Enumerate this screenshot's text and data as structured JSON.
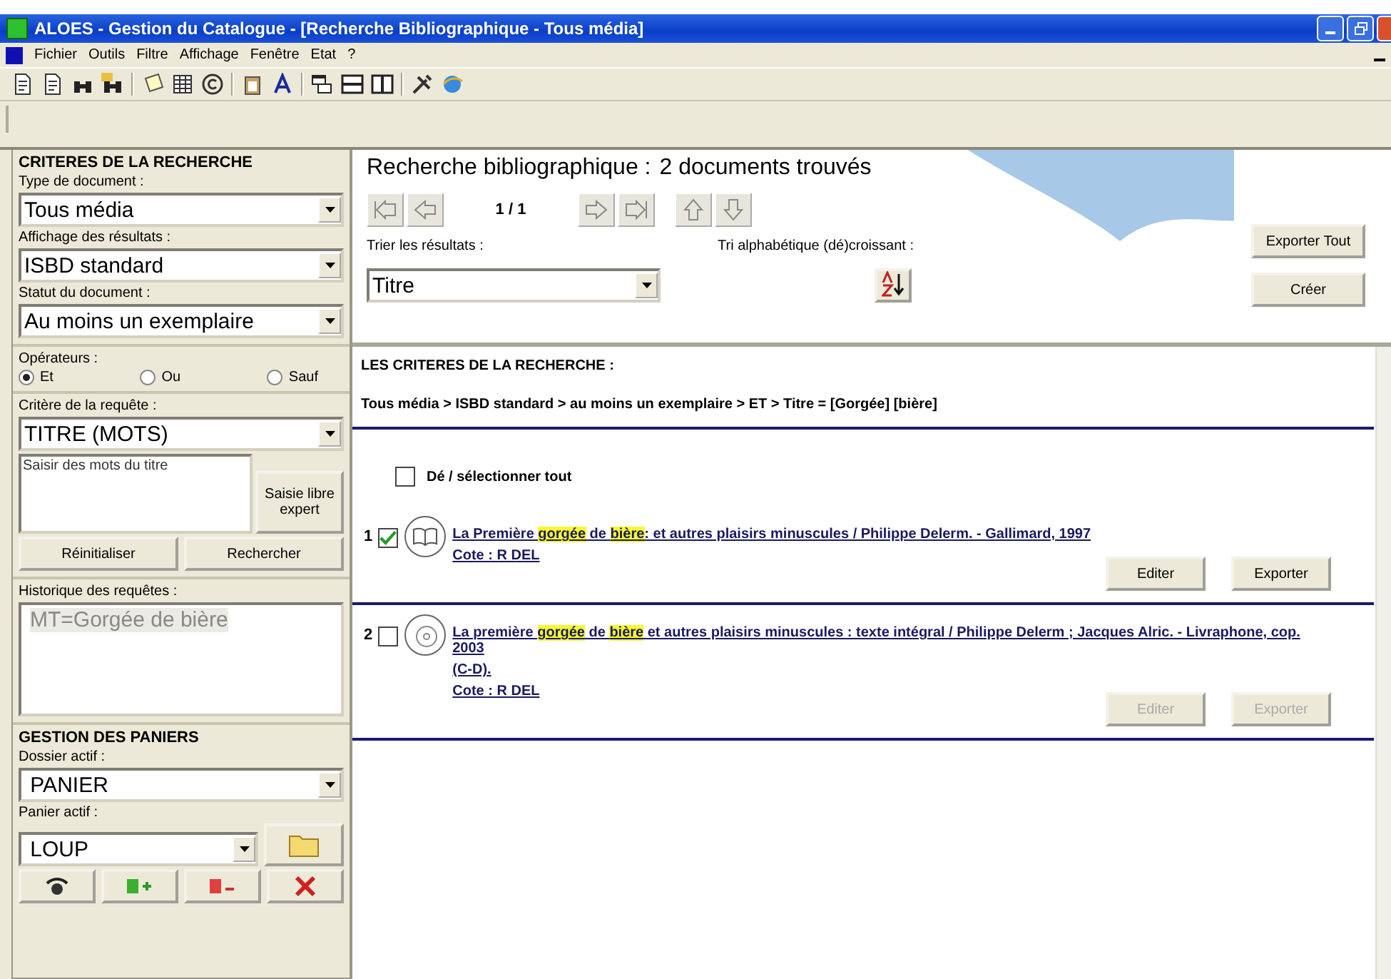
{
  "window": {
    "title": "ALOES - Gestion du Catalogue - [Recherche Bibliographique - Tous média]"
  },
  "menu": [
    "Fichier",
    "Outils",
    "Filtre",
    "Affichage",
    "Fenêtre",
    "Etat",
    "?"
  ],
  "search_panel": {
    "title": "CRITERES DE LA RECHERCHE",
    "selects": [
      {
        "label": "Type de document :",
        "value": "Tous média"
      },
      {
        "label": "Affichage des résultats :",
        "value": "ISBD standard"
      },
      {
        "label": "Statut du document :",
        "value": "Au moins un exemplaire"
      }
    ],
    "operators_label": "Opérateurs :",
    "operators": [
      {
        "label": "Et",
        "selected": true
      },
      {
        "label": "Ou",
        "selected": false
      },
      {
        "label": "Sauf",
        "selected": false
      }
    ],
    "criterion_label": "Critère de la requête :",
    "criterion_value": "TITRE (MOTS)",
    "query": {
      "placeholder": "Saisir des mots du titre"
    },
    "expert_button": "Saisie libre expert",
    "buttons": [
      "Réinitialiser",
      "Rechercher"
    ],
    "history_label": "Historique des requêtes :",
    "history": [
      "MT=Gorgée de bière"
    ]
  },
  "baskets": {
    "title": "GESTION DES PANIERS",
    "folder_label": "Dossier actif :",
    "folder_value": "PANIER",
    "basket_label": "Panier actif :",
    "basket_value": "LOUP"
  },
  "results": {
    "heading": "Recherche bibliographique :",
    "count": "2 documents trouvés",
    "page": "1 / 1",
    "sort_label": "Trier les résultats :",
    "sort_value": "Titre",
    "order_label": "Tri alphabétique (dé)croissant :",
    "export_all": "Exporter Tout",
    "create": "Créer",
    "criteria_title": "LES CRITERES DE LA RECHERCHE :",
    "criteria": "Tous média > ISBD standard > au moins un exemplaire > ET > Titre = [Gorgée] [bière]",
    "select_all": {
      "label": "Dé / sélectionner tout",
      "checked": false
    },
    "items": [
      {
        "number": "1",
        "checked": true,
        "kind": "book",
        "title": [
          {
            "text": "La Première ",
            "highlight": false
          },
          {
            "text": "gorgée",
            "highlight": true
          },
          {
            "text": " de ",
            "highlight": false
          },
          {
            "text": "bière",
            "highlight": true
          },
          {
            "text": ": et autres plaisirs minuscules / Philippe Delerm. - Gallimard, 1997",
            "highlight": false
          }
        ],
        "cote": "Cote : R DEL",
        "buttons": [
          {
            "label": "Editer",
            "disabled": false
          },
          {
            "label": "Exporter",
            "disabled": false
          }
        ]
      },
      {
        "number": "2",
        "checked": false,
        "kind": "cd",
        "title": [
          {
            "text": "La première ",
            "highlight": false
          },
          {
            "text": "gorgée",
            "highlight": true
          },
          {
            "text": " de ",
            "highlight": false
          },
          {
            "text": "bière",
            "highlight": true
          },
          {
            "text": " et autres plaisirs minuscules : texte intégral / Philippe Delerm ; Jacques Alric. - Livraphone, cop. 2003",
            "highlight": false
          }
        ],
        "extra": [
          "(C-D)."
        ],
        "cote": "Cote : R DEL",
        "buttons": [
          {
            "label": "Editer",
            "disabled": true
          },
          {
            "label": "Exporter",
            "disabled": true
          }
        ]
      }
    ]
  }
}
